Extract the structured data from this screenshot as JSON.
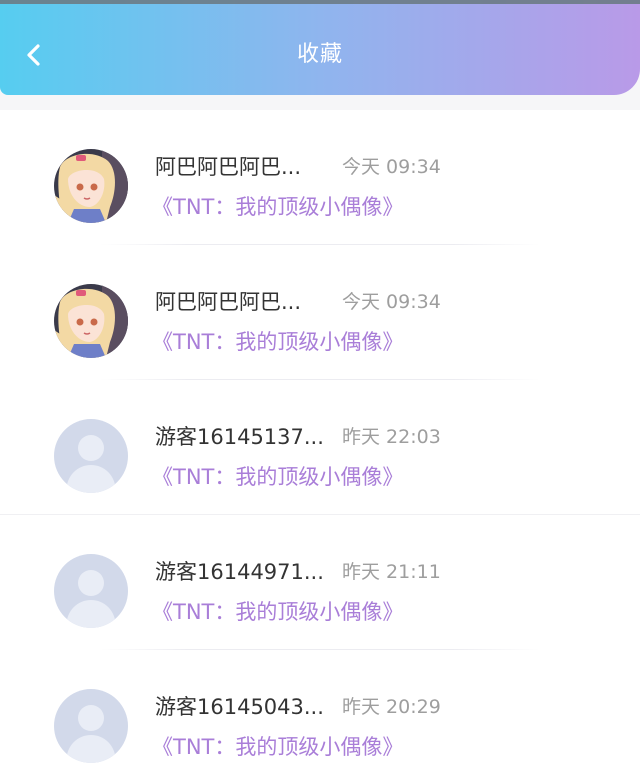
{
  "header": {
    "title": "收藏",
    "back_icon": "chevron-left-icon",
    "gradient_colors": [
      "#56cdf0",
      "#8fb5ee",
      "#b99ae8"
    ]
  },
  "favorites": [
    {
      "name": "阿巴阿巴阿巴...",
      "time": "今天 09:34",
      "work": "《TNT：我的顶级小偶像》",
      "avatar": "anime-avatar"
    },
    {
      "name": "阿巴阿巴阿巴...",
      "time": "今天 09:34",
      "work": "《TNT：我的顶级小偶像》",
      "avatar": "anime-avatar"
    },
    {
      "name": "游客16145137...",
      "time": "昨天 22:03",
      "work": "《TNT：我的顶级小偶像》",
      "avatar": "default-user-avatar"
    },
    {
      "name": "游客16144971...",
      "time": "昨天 21:11",
      "work": "《TNT：我的顶级小偶像》",
      "avatar": "default-user-avatar"
    },
    {
      "name": "游客16145043...",
      "time": "昨天 20:29",
      "work": "《TNT：我的顶级小偶像》",
      "avatar": "default-user-avatar"
    }
  ],
  "colors": {
    "work_title": "#a97ed8",
    "time": "#9e9e9e",
    "name": "#333333"
  }
}
